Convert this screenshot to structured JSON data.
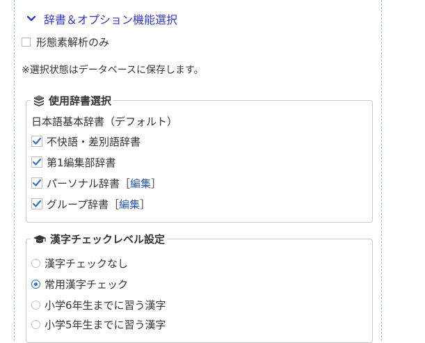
{
  "section": {
    "title": "辞書＆オプション機能選択"
  },
  "morph_only": {
    "label": "形態素解析のみ",
    "checked": false
  },
  "note": "※選択状態はデータベースに保存します。",
  "dict_group": {
    "legend": "使用辞書選択",
    "default_label": "日本語基本辞書（デフォルト）",
    "items": [
      {
        "label": "不快語・差別語辞書",
        "checked": true
      },
      {
        "label": "第1編集部辞書",
        "checked": true
      },
      {
        "label": "パーソナル辞書［",
        "edit": "編集",
        "close": "］",
        "checked": true
      },
      {
        "label": "グループ辞書［",
        "edit": "編集",
        "close": "］",
        "checked": true
      }
    ]
  },
  "kanji_group": {
    "legend": "漢字チェックレベル設定",
    "options": [
      {
        "label": "漢字チェックなし",
        "selected": false
      },
      {
        "label": "常用漢字チェック",
        "selected": true
      },
      {
        "label": "小学6年生までに習う漢字",
        "selected": false
      },
      {
        "label": "小学5年生までに習う漢字",
        "selected": false
      }
    ]
  },
  "colors": {
    "accent": "#2f38c6",
    "check": "#2f6fd1",
    "link": "#2a5db0"
  }
}
